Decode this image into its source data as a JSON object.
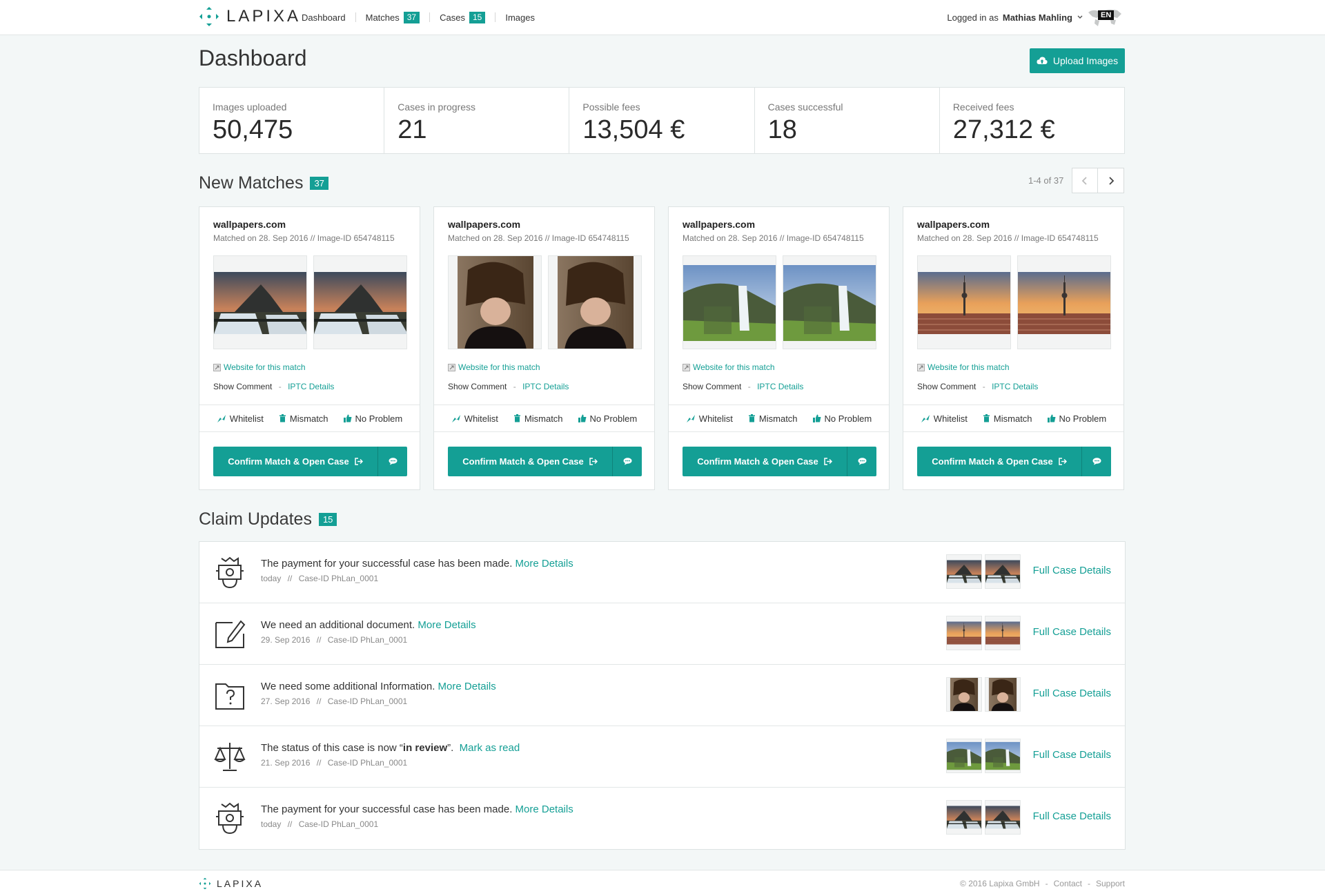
{
  "header": {
    "brand": "LAPIXA",
    "nav": [
      {
        "label": "Dashboard"
      },
      {
        "label": "Matches",
        "badge": "37"
      },
      {
        "label": "Cases",
        "badge": "15"
      },
      {
        "label": "Images"
      }
    ],
    "logged_in_prefix": "Logged in as",
    "user_name": "Mathias Mahling",
    "language": "EN"
  },
  "page": {
    "title": "Dashboard",
    "upload_label": "Upload Images"
  },
  "stats": [
    {
      "label": "Images uploaded",
      "value": "50,475"
    },
    {
      "label": "Cases in progress",
      "value": "21"
    },
    {
      "label": "Possible fees",
      "value": "13,504 €"
    },
    {
      "label": "Cases successful",
      "value": "18"
    },
    {
      "label": "Received fees",
      "value": "27,312 €"
    }
  ],
  "new_matches": {
    "title": "New Matches",
    "count": "37",
    "pager_text": "1-4 of 37",
    "cards": [
      {
        "site": "wallpapers.com",
        "meta": "Matched on 28. Sep 2016 // Image-ID 654748115",
        "image": "mountain-waterfall"
      },
      {
        "site": "wallpapers.com",
        "meta": "Matched on 28. Sep 2016 // Image-ID 654748115",
        "image": "woman-portrait"
      },
      {
        "site": "wallpapers.com",
        "meta": "Matched on 28. Sep 2016 // Image-ID 654748115",
        "image": "waterfall-cliff"
      },
      {
        "site": "wallpapers.com",
        "meta": "Matched on 28. Sep 2016 // Image-ID 654748115",
        "image": "city-tower-sunset"
      }
    ],
    "labels": {
      "website": "Website for this match",
      "show_comment": "Show Comment",
      "separator": "-",
      "iptc": "IPTC Details",
      "whitelist": "Whitelist",
      "mismatch": "Mismatch",
      "no_problem": "No Problem",
      "confirm": "Confirm Match & Open Case"
    }
  },
  "claims": {
    "title": "Claim Updates",
    "count": "15",
    "full_label": "Full Case Details",
    "items": [
      {
        "icon": "payment-icon",
        "text": "The payment for your successful case has been made.",
        "link": "More Details",
        "date": "today",
        "case": "Case-ID PhLan_0001",
        "image": "mountain-waterfall"
      },
      {
        "icon": "document-edit-icon",
        "text": "We need an additional document.",
        "link": "More Details",
        "date": "29. Sep 2016",
        "case": "Case-ID PhLan_0001",
        "image": "city-tower-sunset"
      },
      {
        "icon": "question-folder-icon",
        "text": "We need some additional Information.",
        "link": "More Details",
        "date": "27. Sep 2016",
        "case": "Case-ID PhLan_0001",
        "image": "woman-portrait"
      },
      {
        "icon": "scales-icon",
        "text_pre": "The status of this case is now “",
        "text_bold": "in review",
        "text_post": "”.",
        "link": "Mark as read",
        "date": "21. Sep 2016",
        "case": "Case-ID PhLan_0001",
        "image": "waterfall-cliff"
      },
      {
        "icon": "payment-icon",
        "text": "The payment for your successful case has been made.",
        "link": "More Details",
        "date": "today",
        "case": "Case-ID PhLan_0001",
        "image": "mountain-waterfall"
      }
    ],
    "date_sep": "//"
  },
  "footer": {
    "brand": "LAPIXA",
    "copyright": "© 2016 Lapixa GmbH",
    "sep": "-",
    "contact": "Contact",
    "support": "Support"
  },
  "colors": {
    "accent": "#149f95",
    "background": "#f3f7f7"
  }
}
